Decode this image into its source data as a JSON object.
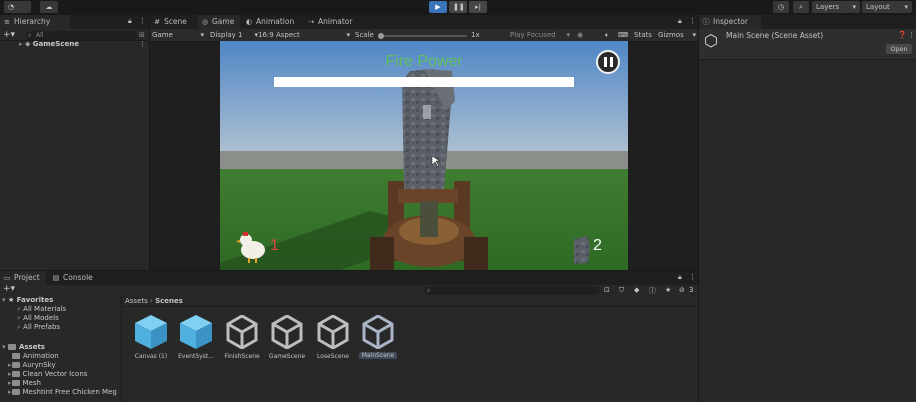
{
  "toolbar": {
    "account": "GG",
    "layers": "Layers",
    "layout": "Layout"
  },
  "hierarchy": {
    "tab": "Hierarchy",
    "search_placeholder": "All",
    "scene": "GameScene"
  },
  "center_tabs": [
    {
      "label": "Scene"
    },
    {
      "label": "Game"
    },
    {
      "label": "Animation"
    },
    {
      "label": "Animator"
    }
  ],
  "game_bar": {
    "mode": "Game",
    "display": "Display 1",
    "aspect": "16:9 Aspect",
    "scale_label": "Scale",
    "scale_value": "1x",
    "play_focused": "Play Focused",
    "stats": "Stats",
    "gizmos": "Gizmos"
  },
  "game_view": {
    "fire_power_label": "Fire Power",
    "fire_power_fill": 1.0,
    "chicken_count": "1",
    "tower_count": "2"
  },
  "inspector": {
    "tab": "Inspector",
    "title": "Main Scene (Scene Asset)",
    "open_button": "Open"
  },
  "bottom_tabs": [
    {
      "label": "Project"
    },
    {
      "label": "Console"
    }
  ],
  "project": {
    "badge": "3",
    "breadcrumb": [
      "Assets",
      "Scenes"
    ],
    "favorites": {
      "label": "Favorites",
      "items": [
        "All Materials",
        "All Models",
        "All Prefabs"
      ]
    },
    "assets": {
      "label": "Assets",
      "items": [
        "Animation",
        "AurynSky",
        "Clean Vector Icons",
        "Mesh",
        "Meshtint Free Chicken Meg"
      ]
    },
    "grid": [
      {
        "label": "Canvas (1)",
        "kind": "prefab"
      },
      {
        "label": "EventSyst...",
        "kind": "prefab"
      },
      {
        "label": "FinishScene",
        "kind": "scene"
      },
      {
        "label": "GameScene",
        "kind": "scene"
      },
      {
        "label": "LoseScene",
        "kind": "scene"
      },
      {
        "label": "MainScene",
        "kind": "scene"
      }
    ]
  },
  "colors": {
    "accent": "#3a73b8",
    "fire_power_text": "#5fbf5f",
    "counter_red": "#e0443f",
    "prefab_blue": "#4fb0e0"
  }
}
